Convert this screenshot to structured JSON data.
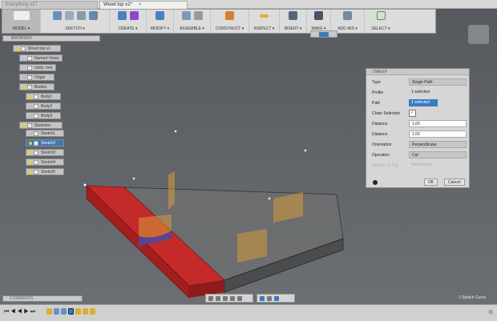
{
  "tabs": [
    {
      "label": "Everything v17",
      "close": "×"
    },
    {
      "label": "Wood top v1*",
      "close": "×"
    }
  ],
  "ribbon": {
    "model": "MODEL ▾",
    "groups": [
      "SKETCH ▾",
      "CREATE ▾",
      "MODIFY ▾",
      "ASSEMBLE ▾",
      "CONSTRUCT ▾",
      "INSPECT ▾",
      "INSERT ▾",
      "MAKE ▾",
      "ADD-INS ▾",
      "SELECT ▾"
    ]
  },
  "browser": {
    "title": "BROWSER",
    "root": "Wood top v1",
    "items": [
      "Named Views",
      "Units: mm",
      "Origin",
      "Bodies",
      "Body1",
      "Body2",
      "Body3",
      "Sketches",
      "Sketch1",
      "Sketch2",
      "Sketch3",
      "Sketch4",
      "Sketch5"
    ],
    "selected": "Sketch2"
  },
  "sweep": {
    "title": "SWEEP",
    "rows": [
      {
        "label": "Type",
        "value": "Single Path"
      },
      {
        "label": "Profile",
        "value": "1 selected"
      },
      {
        "label": "Path",
        "value": "1 selected"
      },
      {
        "label": "Chain Selection",
        "value": "✓"
      },
      {
        "label": "Distance",
        "value": "1.00"
      },
      {
        "label": "Distance",
        "value": "1.00"
      },
      {
        "label": "Orientation",
        "value": "Perpendicular"
      },
      {
        "label": "Operation",
        "value": "Cut"
      },
      {
        "label": "Objects To Cut",
        "value": "New Bodies"
      }
    ],
    "ok": "OK",
    "cancel": "Cancel"
  },
  "comments": "COMMENTS",
  "status": "1 Sketch Curve",
  "colors": {
    "accent": "#3a7cc0",
    "cut_body": "#c0282a",
    "plate": "#6a6a6a"
  }
}
